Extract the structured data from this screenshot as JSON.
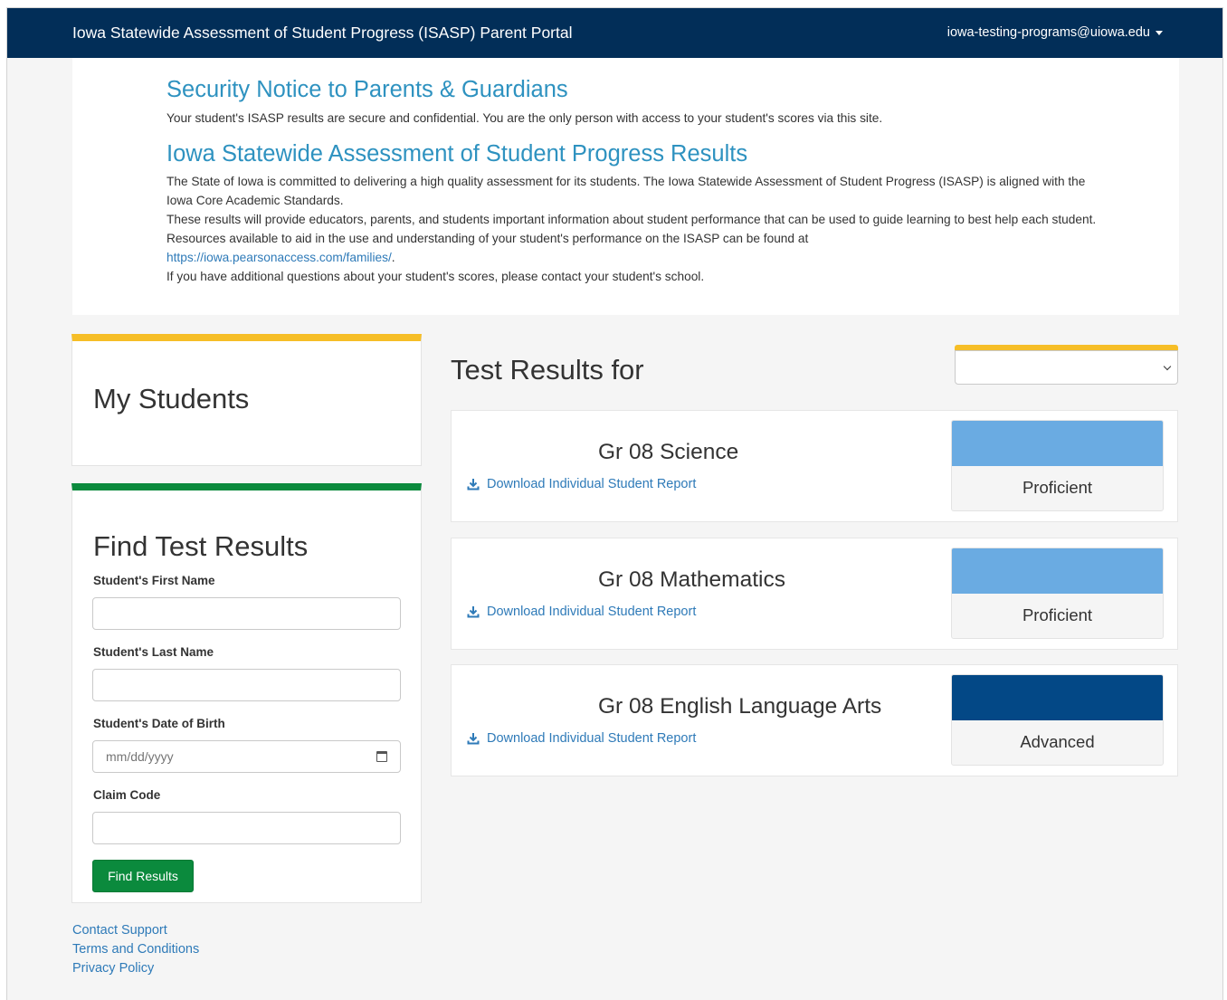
{
  "header": {
    "title": "Iowa Statewide Assessment of Student Progress (ISASP) Parent Portal",
    "user_email": "iowa-testing-programs@uiowa.edu"
  },
  "notice": {
    "security_heading": "Security Notice to Parents & Guardians",
    "security_text": "Your student's ISASP results are secure and confidential. You are the only person with access to your student's scores via this site.",
    "results_heading": "Iowa Statewide Assessment of Student Progress Results",
    "para1": "The State of Iowa is committed to delivering a high quality assessment for its students. The Iowa Statewide Assessment of Student Progress (ISASP) is aligned with the Iowa Core Academic Standards.",
    "para2": "These results will provide educators, parents, and students important information about student performance that can be used to guide learning to best help each student. Resources available to aid in the use and understanding of your student's performance on the ISASP can be found at",
    "link": "https://iowa.pearsonaccess.com/families/",
    "link_suffix": ".",
    "para3": "If you have additional questions about your student's scores, please contact your student's school."
  },
  "my_students": {
    "heading": "My Students"
  },
  "find_form": {
    "heading": "Find Test Results",
    "first_name_label": "Student's First Name",
    "first_name_value": "",
    "last_name_label": "Student's Last Name",
    "last_name_value": "",
    "dob_label": "Student's Date of Birth",
    "dob_placeholder": "mm/dd/yyyy",
    "claim_label": "Claim Code",
    "claim_value": "",
    "button": "Find Results"
  },
  "footer": {
    "contact": "Contact Support",
    "terms": "Terms and Conditions",
    "privacy": "Privacy Policy"
  },
  "results": {
    "title": "Test Results for",
    "student_select_value": "",
    "download_label": "Download Individual Student Report",
    "tests": [
      {
        "subject": "Gr 08 Science",
        "level": "Proficient",
        "color": "#6aabe2"
      },
      {
        "subject": "Gr 08 Mathematics",
        "level": "Proficient",
        "color": "#6aabe2"
      },
      {
        "subject": "Gr 08 English Language Arts",
        "level": "Advanced",
        "color": "#034886"
      }
    ]
  },
  "colors": {
    "navbar": "#022e58",
    "heading_blue": "#2e92c0",
    "link_blue": "#2e7ab8",
    "accent_yellow": "#f6be27",
    "accent_green": "#0b8a3d"
  }
}
